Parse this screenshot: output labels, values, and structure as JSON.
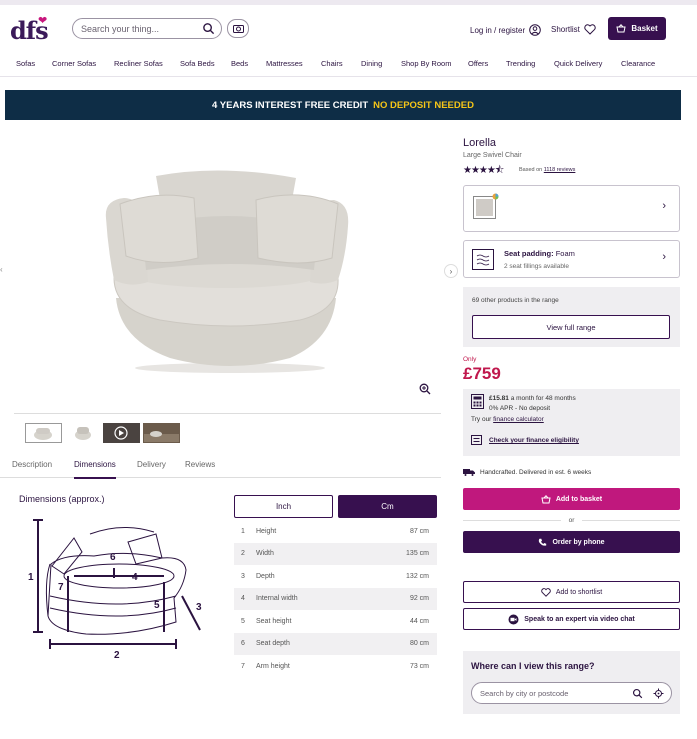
{
  "header": {
    "logo": "dfs",
    "search_placeholder": "Search your thing...",
    "login": "Log in / register",
    "shortlist": "Shortlist",
    "basket": "Basket"
  },
  "nav": [
    "Sofas",
    "Corner Sofas",
    "Recliner Sofas",
    "Sofa Beds",
    "Beds",
    "Mattresses",
    "Chairs",
    "Dining",
    "Shop By Room",
    "Offers",
    "Trending",
    "Quick Delivery",
    "Clearance"
  ],
  "banner": {
    "text": "4 YEARS INTEREST FREE CREDIT",
    "highlight": "NO DEPOSIT NEEDED"
  },
  "tabs": [
    "Description",
    "Dimensions",
    "Delivery",
    "Reviews"
  ],
  "active_tab": "Dimensions",
  "dimensions": {
    "title": "Dimensions (approx.)",
    "units": [
      "Inch",
      "Cm"
    ],
    "selected_unit": "Cm",
    "rows": [
      {
        "num": "1",
        "label": "Height",
        "value": "87 cm"
      },
      {
        "num": "2",
        "label": "Width",
        "value": "135 cm"
      },
      {
        "num": "3",
        "label": "Depth",
        "value": "132 cm"
      },
      {
        "num": "4",
        "label": "Internal width",
        "value": "92 cm"
      },
      {
        "num": "5",
        "label": "Seat height",
        "value": "44 cm"
      },
      {
        "num": "6",
        "label": "Seat depth",
        "value": "80 cm"
      },
      {
        "num": "7",
        "label": "Arm height",
        "value": "73 cm"
      }
    ],
    "diagram_labels": [
      "1",
      "2",
      "3",
      "4",
      "5",
      "6",
      "7"
    ]
  },
  "product": {
    "name": "Lorella",
    "subtitle": "Large Swivel Chair",
    "rating_stars": 4.5,
    "stars_text": "★★★★⯪",
    "reviews_prefix": "Based on",
    "reviews_link": "1118 reviews",
    "seat_padding_label": "Seat padding:",
    "seat_padding_value": "Foam",
    "seat_fillings": "2 seat fillings available",
    "range_text": "69 other products in the range",
    "range_button": "View full range",
    "only": "Only",
    "price": "£759",
    "finance": {
      "monthly": "£15.81",
      "monthly_suffix": "a month for 48 months",
      "apr": "0% APR - No deposit",
      "try_prefix": "Try our",
      "calculator": "finance calculator",
      "eligibility": "Check your finance eligibility"
    },
    "delivery": "Handcrafted. Delivered in est. 6 weeks",
    "add_to_basket": "Add to basket",
    "or": "or",
    "order_by_phone": "Order by phone",
    "add_to_shortlist": "Add to shortlist",
    "video_chat": "Speak to an expert via video chat",
    "where_title": "Where can I view this range?",
    "city_placeholder": "Search by city or postcode"
  },
  "colors": {
    "brand": "#37104f",
    "accent": "#c0187d",
    "price": "#c0184d",
    "banner": "#0e2d46",
    "banner_highlight": "#f5c518"
  }
}
